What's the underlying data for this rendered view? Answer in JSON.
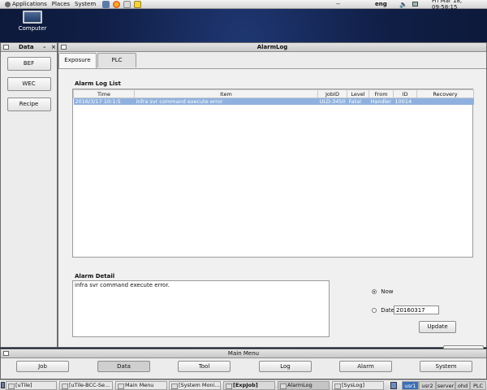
{
  "top_panel": {
    "menus": [
      "Applications",
      "Places",
      "System"
    ],
    "center_text": "--",
    "keyboard": "eng",
    "clock": "Fri Mar 18, 09:58:15"
  },
  "desktop": {
    "icon_label": "Computer"
  },
  "data_window": {
    "title": "Data",
    "buttons": [
      "BEF",
      "WEC",
      "Recipe"
    ]
  },
  "alarm_window": {
    "title": "AlarmLog",
    "tabs": [
      "Exposure",
      "PLC"
    ],
    "list_label": "Alarm Log List",
    "columns": [
      "Time",
      "Item",
      "JobID",
      "Level",
      "From",
      "ID",
      "Recovery"
    ],
    "rows": [
      {
        "time": "2016/3/17 10:1:5",
        "item": "infra svr command execute error",
        "jobid": "ULD-3450",
        "level": "Fatal",
        "from": "Handler",
        "id": "10014",
        "recovery": ""
      }
    ],
    "detail_label": "Alarm Detail",
    "detail_text": "infra svr command execute error.",
    "radio_now": "Now",
    "radio_date": "Date",
    "date_value": "20160317",
    "update_label": "Update"
  },
  "main_menu": {
    "title": "Main Menu",
    "buttons": [
      "Job",
      "Data",
      "Tool",
      "Log",
      "Alarm",
      "System"
    ]
  },
  "taskbar": {
    "tasks": [
      "[uTile]",
      "[uTile-BCC-Se...",
      "Main Menu",
      "[System Moni...",
      "[ExpJob]",
      "AlarmLog",
      "[SysLog]"
    ],
    "workspaces": [
      "usr1",
      "usr2",
      "server",
      "ohd",
      "PLC"
    ]
  },
  "colors": {
    "selection": "#8fb1df",
    "desktop": "#101f47",
    "workspace_active": "#3b6fb6"
  }
}
